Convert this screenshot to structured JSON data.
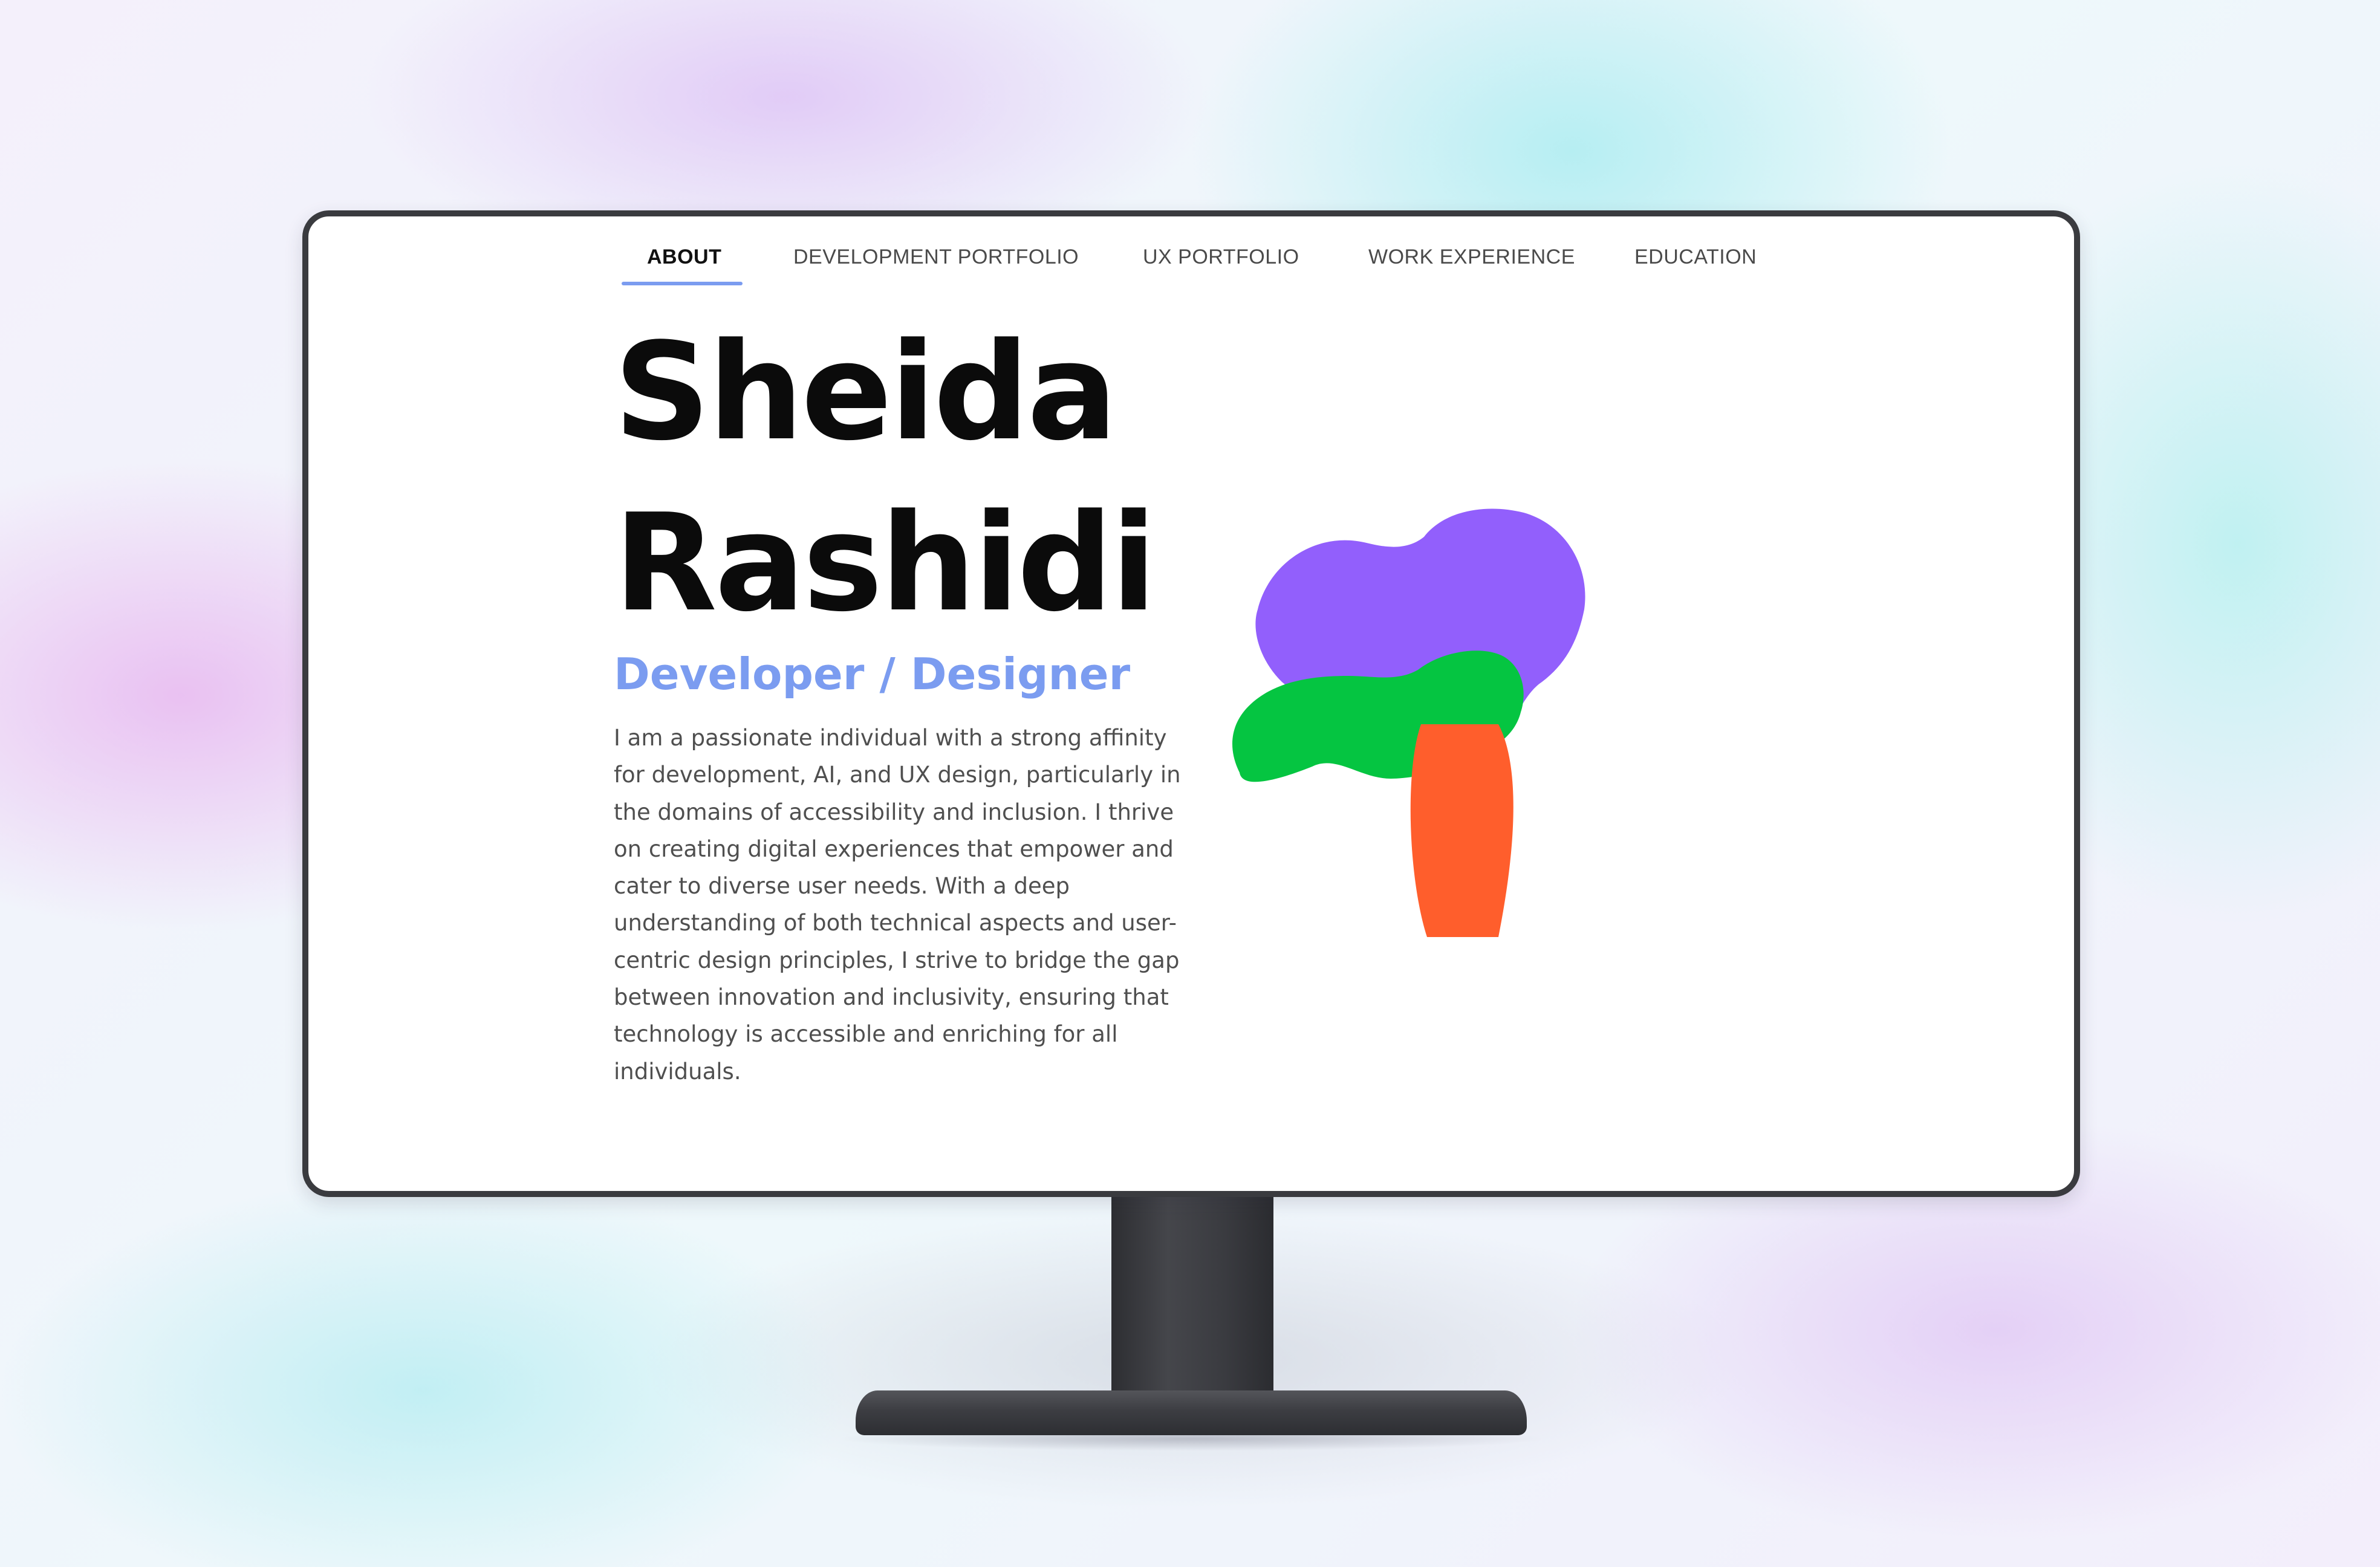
{
  "nav": {
    "items": [
      {
        "label": "ABOUT",
        "active": true
      },
      {
        "label": "DEVELOPMENT PORTFOLIO",
        "active": false
      },
      {
        "label": "UX PORTFOLIO",
        "active": false
      },
      {
        "label": "WORK EXPERIENCE",
        "active": false
      },
      {
        "label": "EDUCATION",
        "active": false
      }
    ]
  },
  "hero": {
    "first_name": "Sheida",
    "last_name": "Rashidi",
    "role": "Developer / Designer",
    "bio": "I am a passionate individual with a strong affinity for development, AI, and UX design, particularly in the domains of accessibility and inclusion. I thrive on creating digital experiences that empower and cater to diverse user needs. With a deep understanding of both technical aspects and user-centric design principles, I strive to bridge the gap between innovation and inclusivity, ensuring that technology is accessible and enriching for all individuals."
  },
  "colors": {
    "accent": "#7b9cf0",
    "blob_purple": "#925ffc",
    "blob_green": "#05c541",
    "blob_orange": "#ff5e2c",
    "monitor": "#3a3b3f"
  },
  "illustration": {
    "name": "abstract-blob-art"
  }
}
